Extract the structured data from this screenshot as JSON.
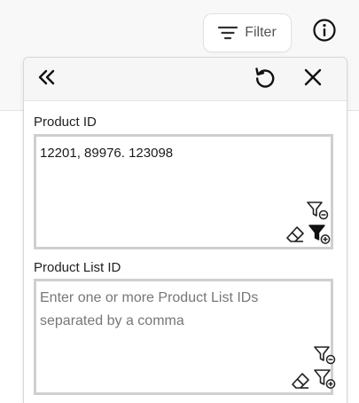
{
  "toolbar": {
    "filter_label": "Filter",
    "filter_icon": "filter-lines-icon",
    "info_icon": "info-icon"
  },
  "panel": {
    "collapse_icon": "double-chevron-left-icon",
    "reset_icon": "reset-icon",
    "close_icon": "close-icon",
    "fields": [
      {
        "label": "Product ID",
        "value": "12201, 89976. 123098",
        "placeholder": "",
        "icons": [
          "filter-remove-icon",
          "eraser-icon",
          "filter-add-filled-icon"
        ]
      },
      {
        "label": "Product List ID",
        "value": "",
        "placeholder": "Enter one or more Product List IDs separated by a comma",
        "icons": [
          "filter-remove-icon",
          "eraser-icon",
          "filter-add-icon"
        ]
      }
    ]
  },
  "colors": {
    "panel_header_bg": "#f6f6f6",
    "field_border": "#cfcfcf",
    "icon": "#222222"
  }
}
